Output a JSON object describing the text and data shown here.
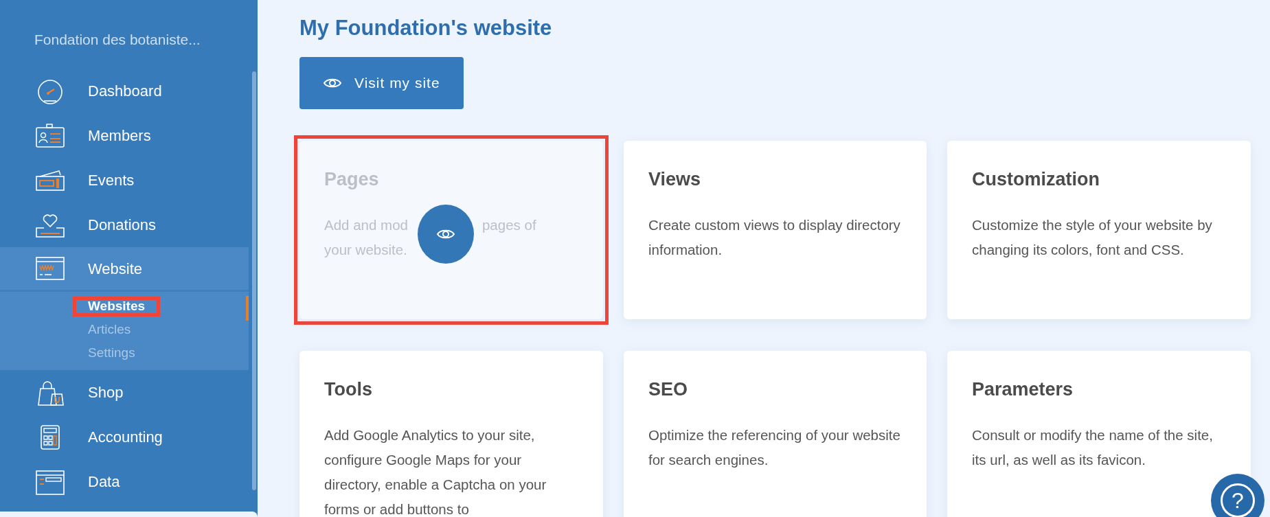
{
  "sidebar": {
    "organization": "Fondation des botaniste...",
    "items": [
      {
        "label": "Dashboard",
        "expanded": false
      },
      {
        "label": "Members",
        "expanded": false
      },
      {
        "label": "Events",
        "expanded": false
      },
      {
        "label": "Donations",
        "expanded": false
      },
      {
        "label": "Website",
        "expanded": true,
        "children": [
          {
            "label": "Websites",
            "selected": true,
            "highlighted": true
          },
          {
            "label": "Articles",
            "selected": false,
            "highlighted": false
          },
          {
            "label": "Settings",
            "selected": false,
            "highlighted": false
          }
        ]
      },
      {
        "label": "Shop",
        "expanded": false
      },
      {
        "label": "Accounting",
        "expanded": false
      },
      {
        "label": "Data",
        "expanded": false
      }
    ]
  },
  "page_title": "My Foundation's website",
  "visit_button": "Visit my site",
  "cards": [
    {
      "title": "Pages",
      "description_parts": [
        "Add and mod",
        "pages of",
        "your website."
      ],
      "hovered": true,
      "highlighted": true
    },
    {
      "title": "Views",
      "description": "Create custom views to display directory information.",
      "hovered": false,
      "highlighted": false
    },
    {
      "title": "Customization",
      "description": "Customize the style of your website by changing its colors, font and CSS.",
      "hovered": false,
      "highlighted": false
    },
    {
      "title": "Tools",
      "description": "Add Google Analytics to your site, configure Google Maps for your directory, enable a Captcha on your forms or add buttons to",
      "hovered": false,
      "highlighted": false
    },
    {
      "title": "SEO",
      "description": "Optimize the referencing of your website for search engines.",
      "hovered": false,
      "highlighted": false
    },
    {
      "title": "Parameters",
      "description": "Consult or modify the name of the site, its url, as well as its favicon.",
      "hovered": false,
      "highlighted": false
    }
  ],
  "help_button": "?"
}
